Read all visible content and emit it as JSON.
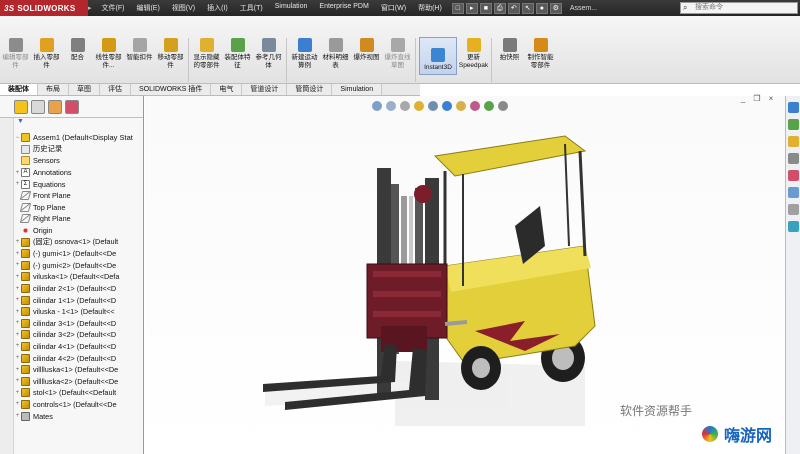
{
  "app": {
    "logo_ds": "3S",
    "logo_text": "SOLIDWORKS",
    "document_title": "Assem...",
    "search_placeholder": "搜索命令"
  },
  "menu": [
    "文件(F)",
    "编辑(E)",
    "视图(V)",
    "插入(I)",
    "工具(T)",
    "Simulation",
    "Enterprise PDM",
    "窗口(W)",
    "帮助(H)"
  ],
  "ribbon": {
    "buttons": [
      {
        "label": "编辑零部件",
        "disabled": true,
        "color": "#8c8c8c"
      },
      {
        "label": "插入零部件",
        "disabled": false,
        "color": "#e0a020"
      },
      {
        "label": "配合",
        "disabled": false,
        "color": "#7f7f7f"
      },
      {
        "label": "线性零部件...",
        "disabled": false,
        "color": "#d49a12"
      },
      {
        "label": "智能扣件",
        "disabled": false,
        "color": "#a5a5a5"
      },
      {
        "label": "移动零部件",
        "disabled": false,
        "color": "#d4a020"
      },
      {
        "label": "显示隐藏的零部件",
        "disabled": false,
        "color": "#e0b030"
      },
      {
        "label": "装配体特征",
        "disabled": false,
        "color": "#5aa24a"
      },
      {
        "label": "参考几何体",
        "disabled": false,
        "color": "#7a8a9a"
      },
      {
        "label": "新建运动算例",
        "disabled": false,
        "color": "#3c7fd0"
      },
      {
        "label": "材料明细表",
        "disabled": false,
        "color": "#9a9a9a"
      },
      {
        "label": "爆炸视图",
        "disabled": false,
        "color": "#d08a20"
      },
      {
        "label": "爆炸直线草图",
        "disabled": true,
        "color": "#a8a8a8"
      },
      {
        "label": "Instant3D",
        "disabled": false,
        "color": "#3a86d0"
      },
      {
        "label": "更新Speedpak",
        "disabled": false,
        "color": "#e6b020"
      },
      {
        "label": "拍快照",
        "disabled": false,
        "color": "#7a7a7a"
      },
      {
        "label": "制作智能零部件",
        "disabled": false,
        "color": "#d68a18"
      }
    ]
  },
  "tabs": [
    "装配体",
    "布局",
    "草图",
    "评估",
    "SOLIDWORKS 插件",
    "电气",
    "管道设计",
    "管筒设计",
    "Simulation"
  ],
  "tree": {
    "root": "Assem1  (Default<Display Stat",
    "nodes": [
      {
        "label": "历史记录",
        "icon": "history-icon",
        "type": "hist",
        "expand": ""
      },
      {
        "label": "Sensors",
        "icon": "sensors-icon",
        "type": "sens",
        "expand": ""
      },
      {
        "label": "Annotations",
        "icon": "annotations-icon",
        "type": "ann",
        "expand": "+"
      },
      {
        "label": "Equations",
        "icon": "equations-icon",
        "type": "eq",
        "expand": "+"
      },
      {
        "label": "Front Plane",
        "icon": "plane-icon",
        "type": "plane",
        "expand": ""
      },
      {
        "label": "Top Plane",
        "icon": "plane-icon",
        "type": "plane",
        "expand": ""
      },
      {
        "label": "Right Plane",
        "icon": "plane-icon",
        "type": "plane",
        "expand": ""
      },
      {
        "label": "Origin",
        "icon": "origin-icon",
        "type": "orig",
        "expand": ""
      },
      {
        "label": "(固定) osnova<1> (Default",
        "icon": "part-icon",
        "type": "part",
        "expand": "+"
      },
      {
        "label": "(-) gumi<1> (Default<<De",
        "icon": "part-icon",
        "type": "part",
        "expand": "+"
      },
      {
        "label": "(-) gumi<2> (Default<<De",
        "icon": "part-icon",
        "type": "part",
        "expand": "+"
      },
      {
        "label": "viluska<1> (Default<<Defa",
        "icon": "part-icon",
        "type": "part",
        "expand": "+"
      },
      {
        "label": "cilindar 2<1> (Default<<D",
        "icon": "part-icon",
        "type": "part",
        "expand": "+"
      },
      {
        "label": "cilindar 1<1> (Default<<D",
        "icon": "part-icon",
        "type": "part",
        "expand": "+"
      },
      {
        "label": "viluska - 1<1> (Default<<",
        "icon": "part-icon",
        "type": "part",
        "expand": "+"
      },
      {
        "label": "cilindar 3<1> (Default<<D",
        "icon": "part-icon",
        "type": "part",
        "expand": "+"
      },
      {
        "label": "cilindar 3<2> (Default<<D",
        "icon": "part-icon",
        "type": "part",
        "expand": "+"
      },
      {
        "label": "cilindar 4<1> (Default<<D",
        "icon": "part-icon",
        "type": "part",
        "expand": "+"
      },
      {
        "label": "cilindar 4<2> (Default<<D",
        "icon": "part-icon",
        "type": "part",
        "expand": "+"
      },
      {
        "label": "villlluska<1> (Default<<De",
        "icon": "part-icon",
        "type": "part",
        "expand": "+"
      },
      {
        "label": "villlluska<2> (Default<<De",
        "icon": "part-icon",
        "type": "part",
        "expand": "+"
      },
      {
        "label": "stol<1> (Default<<Default",
        "icon": "part-icon",
        "type": "part",
        "expand": "+"
      },
      {
        "label": "controls<1> (Default<<De",
        "icon": "part-icon",
        "type": "part",
        "expand": "+"
      },
      {
        "label": "Mates",
        "icon": "mates-icon",
        "type": "mate",
        "expand": "+"
      }
    ]
  },
  "watermark": "软件资源帮手",
  "brand": "嗨游网",
  "colors": {
    "body_yellow": "#e8d43a",
    "mast_dark": "#3a3a3a",
    "carriage_red": "#7a1f2a",
    "accent_blue": "#1565c0"
  }
}
